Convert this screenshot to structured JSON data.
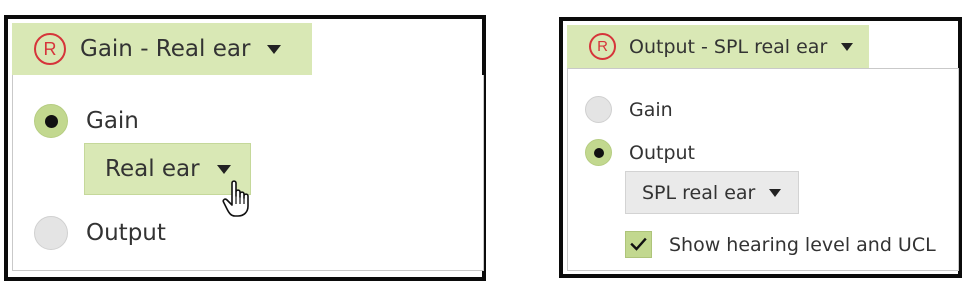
{
  "left_panel": {
    "header": {
      "badge": "R",
      "label": "Gain - Real ear"
    },
    "options": [
      {
        "label": "Gain",
        "selected": true
      },
      {
        "label": "Output",
        "selected": false
      }
    ],
    "sub_dropdown": {
      "value": "Real ear"
    }
  },
  "right_panel": {
    "header": {
      "badge": "R",
      "label": "Output - SPL real ear"
    },
    "options": [
      {
        "label": "Gain",
        "selected": false
      },
      {
        "label": "Output",
        "selected": true
      }
    ],
    "sub_dropdown": {
      "value": "SPL real ear"
    },
    "checkbox": {
      "label": "Show hearing level and UCL",
      "checked": true
    }
  },
  "colors": {
    "accent_green": "#d9e8b5",
    "radio_selected": "#c2d88f",
    "badge_red": "#d6343a"
  },
  "icons": [
    "r-badge-icon",
    "caret-down-icon",
    "hand-cursor-icon",
    "checkmark-icon"
  ]
}
